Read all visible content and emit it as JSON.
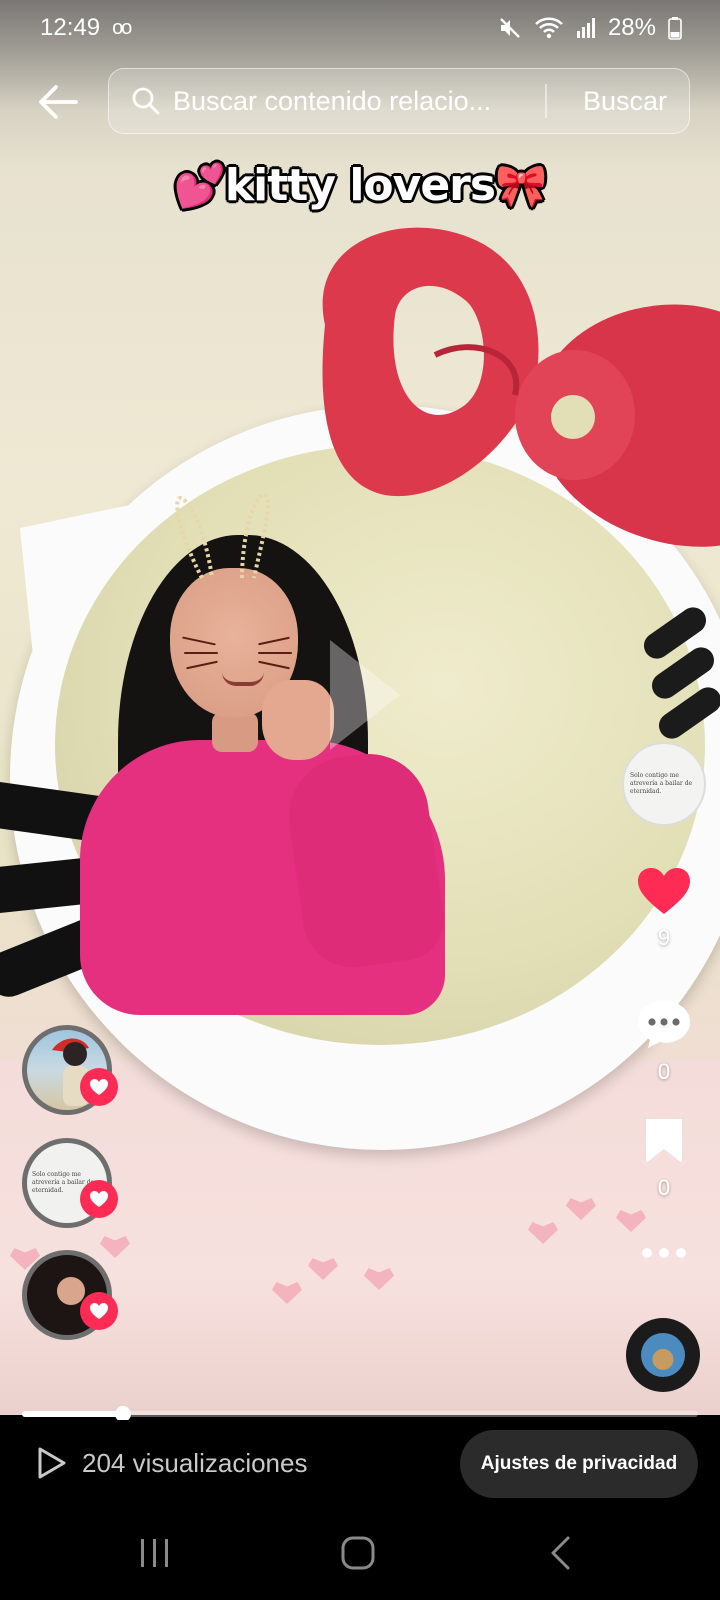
{
  "status_bar": {
    "time": "12:49",
    "voicemail_icon": "oo",
    "battery_percent": "28%",
    "icons": [
      "mute-icon",
      "wifi-icon",
      "signal-icon",
      "battery-icon"
    ]
  },
  "header": {
    "back_icon": "arrow-left-icon",
    "search_placeholder": "Buscar contenido relacio...",
    "search_button": "Buscar"
  },
  "video": {
    "caption_text": "kitty lovers",
    "caption_emoji_left": "💕",
    "caption_emoji_right": "🎀",
    "thumbnail_text": "Solo contigo me atrevería a bailar de eternidad."
  },
  "actions": {
    "likes": "9",
    "comments": "0",
    "saves": "0",
    "liked_color": "#fe2c55"
  },
  "likers": [
    {
      "avatar": "avatar-santa-hat"
    },
    {
      "avatar": "avatar-text-post",
      "text": "Solo contigo me atrevería a bailar de eternidad."
    },
    {
      "avatar": "avatar-girl-portrait"
    }
  ],
  "playback": {
    "progress_fraction": 0.15
  },
  "footer": {
    "views_label": "204 visualizaciones",
    "privacy_button": "Ajustes de privacidad"
  },
  "navigation": [
    "recents-icon",
    "home-icon",
    "back-icon"
  ]
}
